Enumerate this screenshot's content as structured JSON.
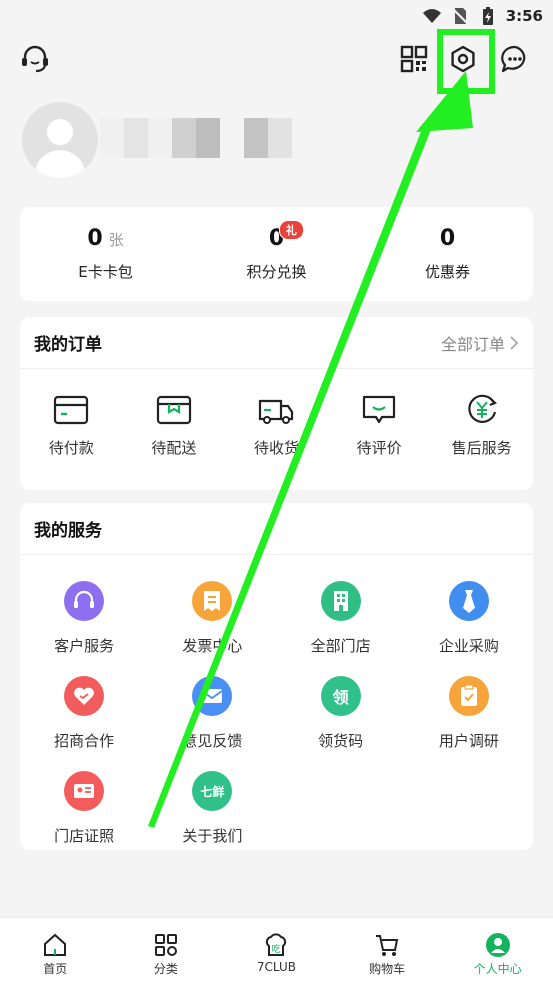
{
  "status_bar": {
    "time": "3:56"
  },
  "header": {
    "service_icon": "headset-icon",
    "qr_icon": "qrcode-icon",
    "settings_icon": "gear-icon",
    "message_icon": "chat-icon"
  },
  "stats": [
    {
      "value": "0",
      "unit": "张",
      "label": "E卡卡包"
    },
    {
      "value": "0",
      "badge": "礼",
      "label": "积分兑换"
    },
    {
      "value": "0",
      "label": "优惠券"
    }
  ],
  "orders": {
    "title": "我的订单",
    "more": "全部订单",
    "items": [
      {
        "label": "待付款",
        "icon": "wallet-icon"
      },
      {
        "label": "待配送",
        "icon": "package-icon"
      },
      {
        "label": "待收货",
        "icon": "truck-icon"
      },
      {
        "label": "待评价",
        "icon": "comment-icon"
      },
      {
        "label": "售后服务",
        "icon": "yuan-refresh-icon"
      }
    ]
  },
  "services": {
    "title": "我的服务",
    "items": [
      {
        "label": "客户服务",
        "icon": "headset-icon",
        "color": "#8e6ff0"
      },
      {
        "label": "发票中心",
        "icon": "invoice-icon",
        "color": "#f7a43a"
      },
      {
        "label": "全部门店",
        "icon": "building-icon",
        "color": "#2fbf85"
      },
      {
        "label": "企业采购",
        "icon": "tie-icon",
        "color": "#3f8ef0"
      },
      {
        "label": "招商合作",
        "icon": "handshake-heart-icon",
        "color": "#f25c5c"
      },
      {
        "label": "意见反馈",
        "icon": "envelope-icon",
        "color": "#4a8ff5"
      },
      {
        "label": "领货码",
        "icon": "receive-code-icon",
        "color": "#30c08a",
        "glyph": "领"
      },
      {
        "label": "用户调研",
        "icon": "clipboard-icon",
        "color": "#f7a43a"
      },
      {
        "label": "门店证照",
        "icon": "license-card-icon",
        "color": "#f25c5c"
      },
      {
        "label": "关于我们",
        "icon": "brand-logo-icon",
        "color": "#30c08a",
        "glyph": "七鲜"
      }
    ]
  },
  "bottom_nav": [
    {
      "label": "首页",
      "icon": "home-icon"
    },
    {
      "label": "分类",
      "icon": "category-icon"
    },
    {
      "label": "7CLUB",
      "icon": "chef-hat-icon",
      "glyph": "吃"
    },
    {
      "label": "购物车",
      "icon": "cart-icon"
    },
    {
      "label": "个人中心",
      "icon": "profile-icon",
      "active": true
    }
  ],
  "colors": {
    "accent": "#13b35d",
    "badge": "#e8423b",
    "annotation": "#22ee22"
  }
}
